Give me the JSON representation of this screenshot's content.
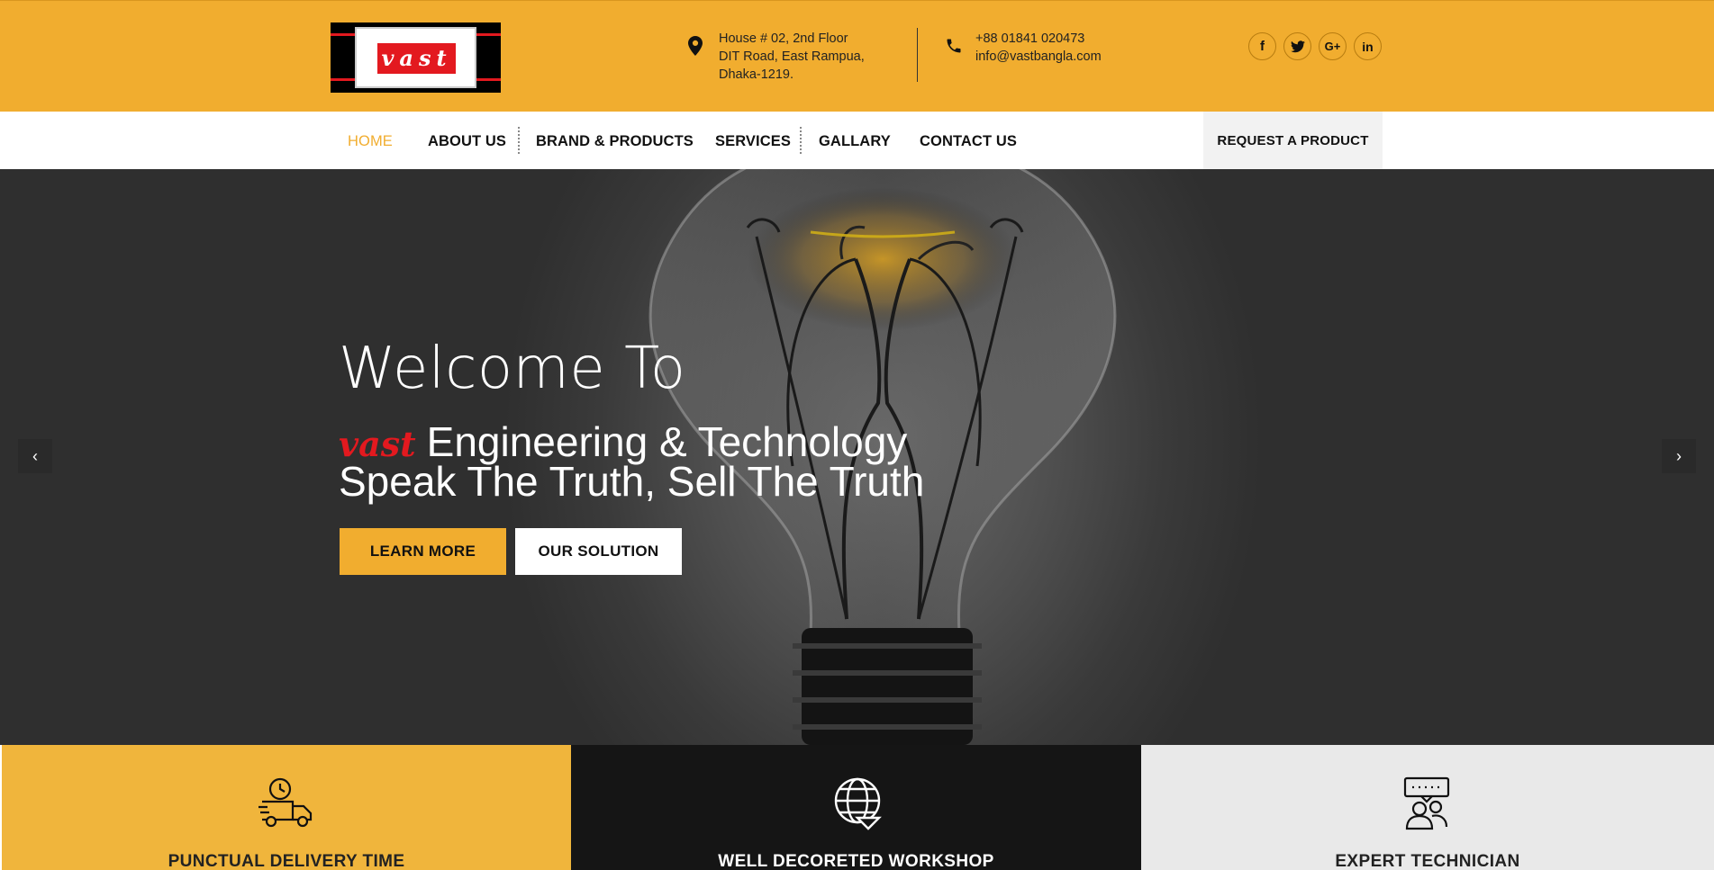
{
  "brand": {
    "logo_text": "vast",
    "accent": "#f1ad2f",
    "brand_red": "#e3191f"
  },
  "topbar": {
    "address_lines": [
      "House # 02, 2nd Floor",
      "DIT Road, East Rampua,",
      "Dhaka-1219."
    ],
    "phone": "+88 01841 020473",
    "email": "info@vastbangla.com",
    "social": [
      {
        "name": "facebook",
        "glyph": "f"
      },
      {
        "name": "twitter",
        "glyph": "t"
      },
      {
        "name": "google-plus",
        "glyph": "G+"
      },
      {
        "name": "linkedin",
        "glyph": "in"
      }
    ]
  },
  "nav": {
    "items": [
      "HOME",
      "ABOUT US",
      "BRAND & PRODUCTS",
      "SERVICES",
      "GALLARY",
      "CONTACT US"
    ],
    "active": "HOME",
    "cta": "REQUEST A PRODUCT"
  },
  "hero": {
    "welcome": "Welcome To",
    "brand_word": "vast",
    "line1": "Engineering & Technology",
    "line2": "Speak The Truth, Sell The Truth",
    "primary_button": "LEARN MORE",
    "secondary_button": "OUR SOLUTION",
    "prev_arrow": "‹",
    "next_arrow": "›"
  },
  "features": [
    {
      "title": "PUNCTUAL DELIVERY TIME",
      "icon": "delivery-truck-icon"
    },
    {
      "title": "WELL DECORETED WORKSHOP",
      "icon": "globe-icon"
    },
    {
      "title": "EXPERT TECHNICIAN",
      "icon": "technician-chat-icon"
    }
  ]
}
